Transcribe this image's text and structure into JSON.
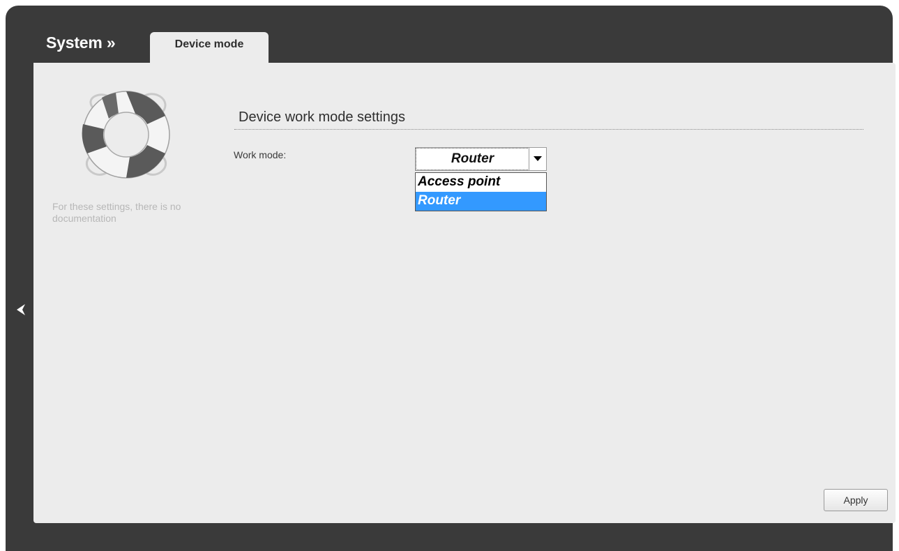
{
  "header": {
    "breadcrumb_root": "System »",
    "active_tab": "Device mode"
  },
  "sidebar": {
    "help_text": "For these settings, there is no documentation",
    "icon": "lifebuoy-icon",
    "collapse_icon": "chevron-left-icon"
  },
  "main": {
    "section_title": "Device work mode settings",
    "work_mode": {
      "label": "Work mode:",
      "selected_value": "Router",
      "options": [
        "Access point",
        "Router"
      ],
      "highlighted_option": "Router"
    },
    "apply_label": "Apply"
  },
  "colors": {
    "frame": "#3a3a3a",
    "panel": "#ececec",
    "selection": "#3399ff"
  }
}
